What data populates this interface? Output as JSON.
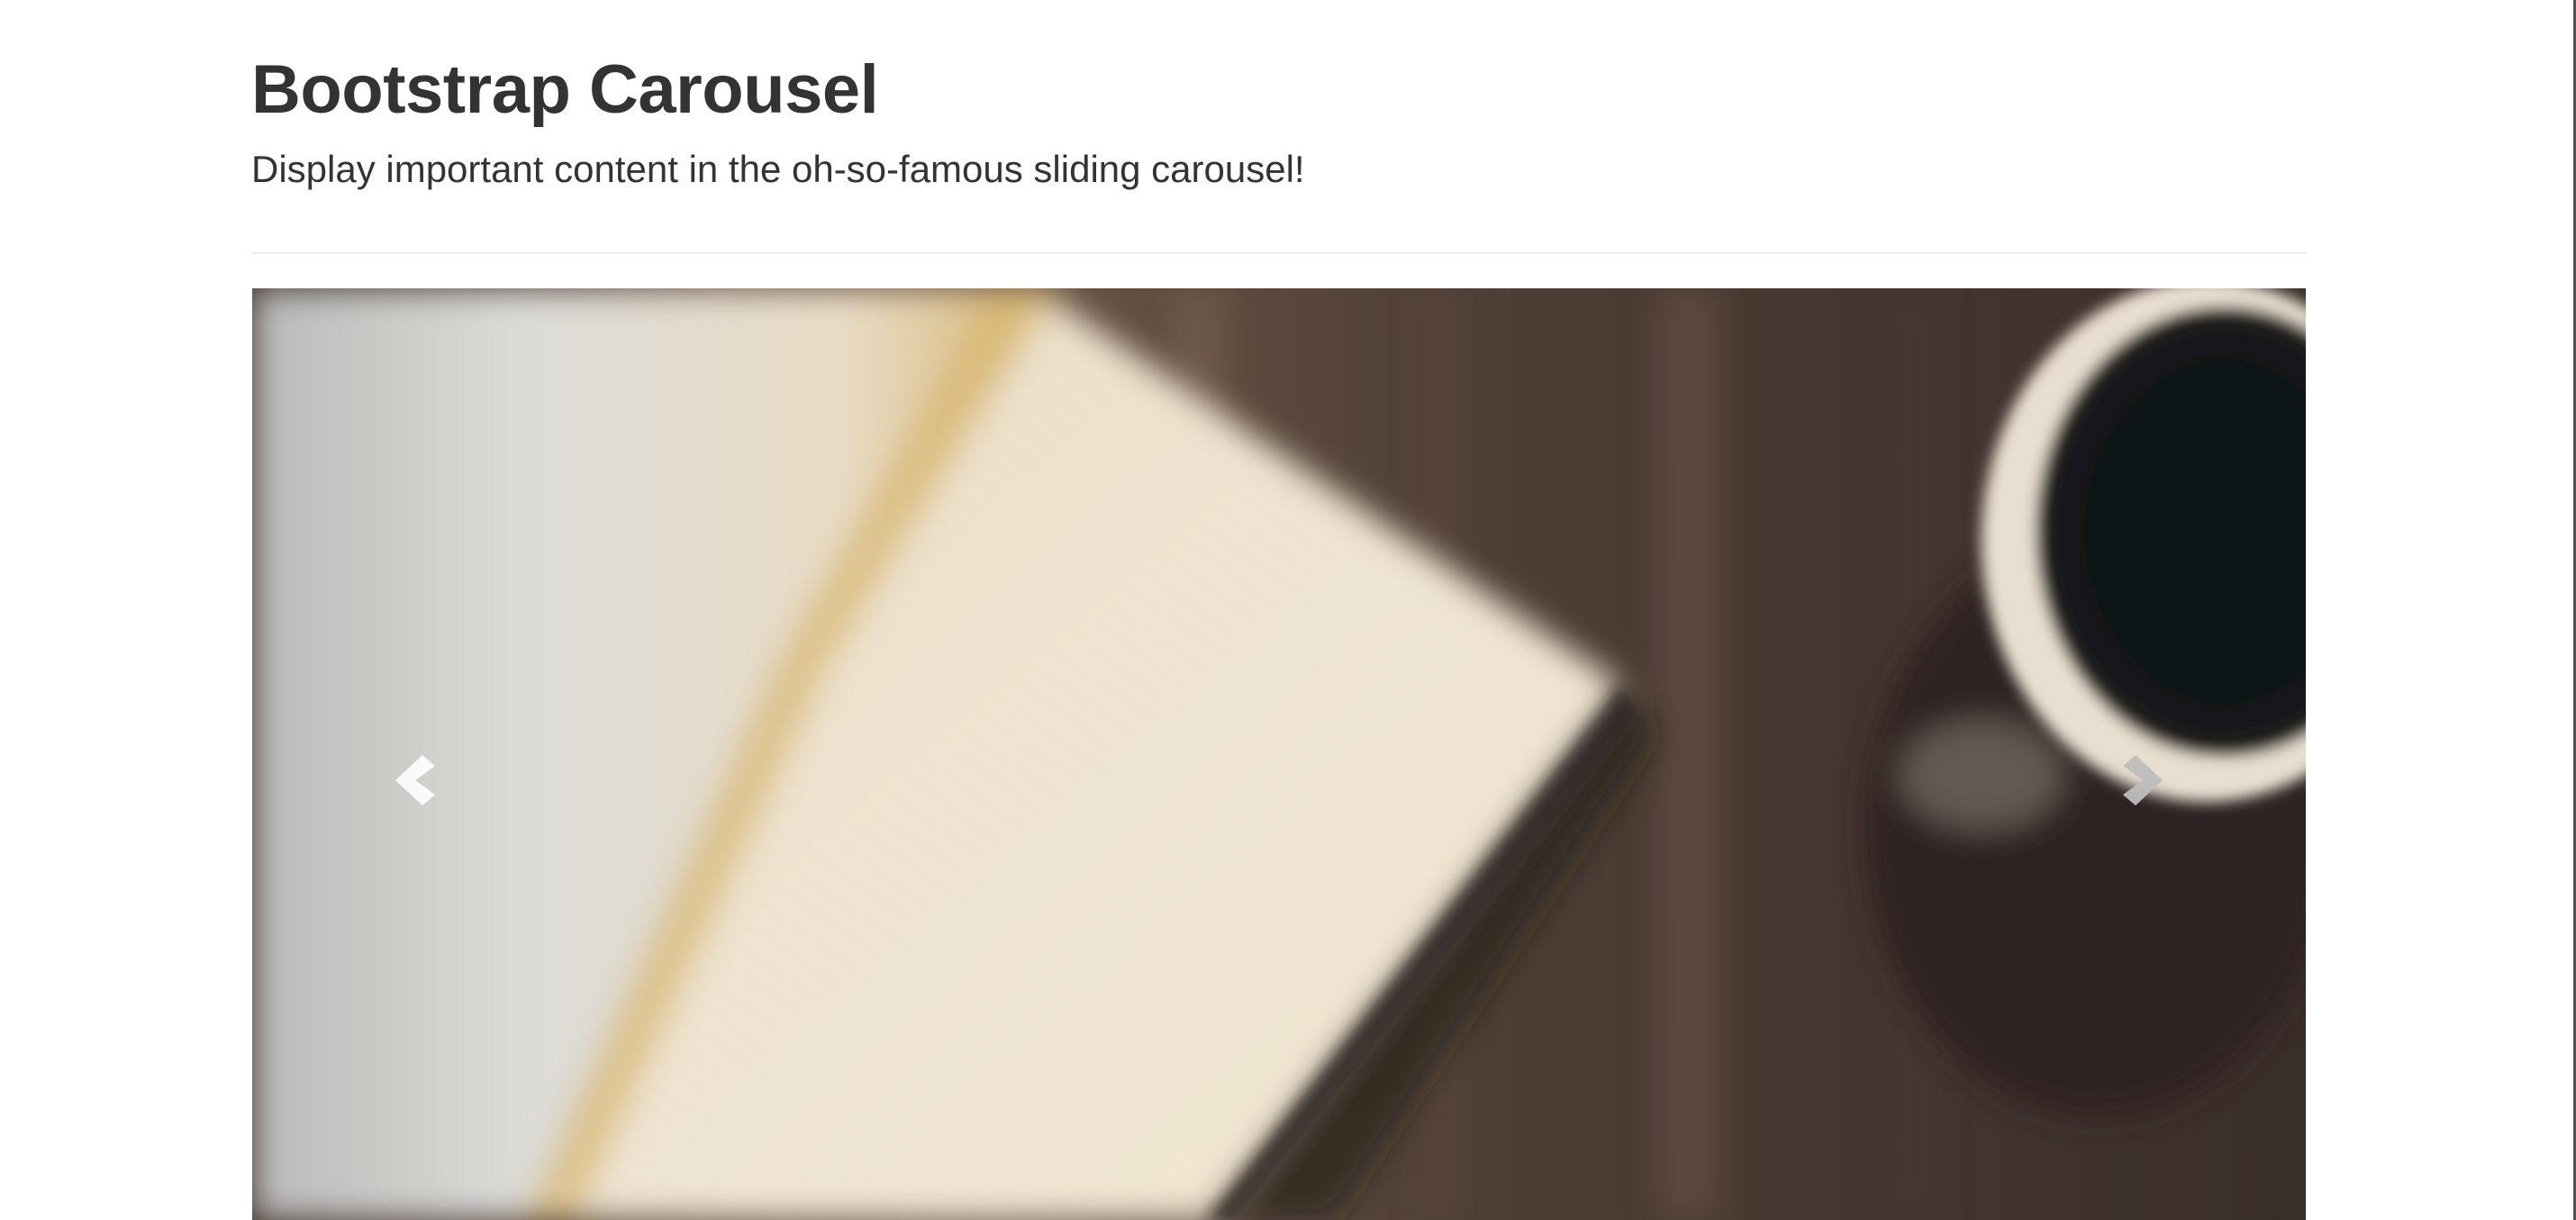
{
  "header": {
    "title": "Bootstrap Carousel",
    "lead": "Display important content in the oh-so-famous sliding carousel!"
  },
  "carousel": {
    "slide": {
      "description": "notebook-and-coffee-photo"
    },
    "controls": {
      "prev_icon": "chevron-left-icon",
      "next_icon": "chevron-right-icon"
    }
  },
  "colors": {
    "text": "#333333",
    "divider": "#eeeeee",
    "background": "#ffffff"
  }
}
